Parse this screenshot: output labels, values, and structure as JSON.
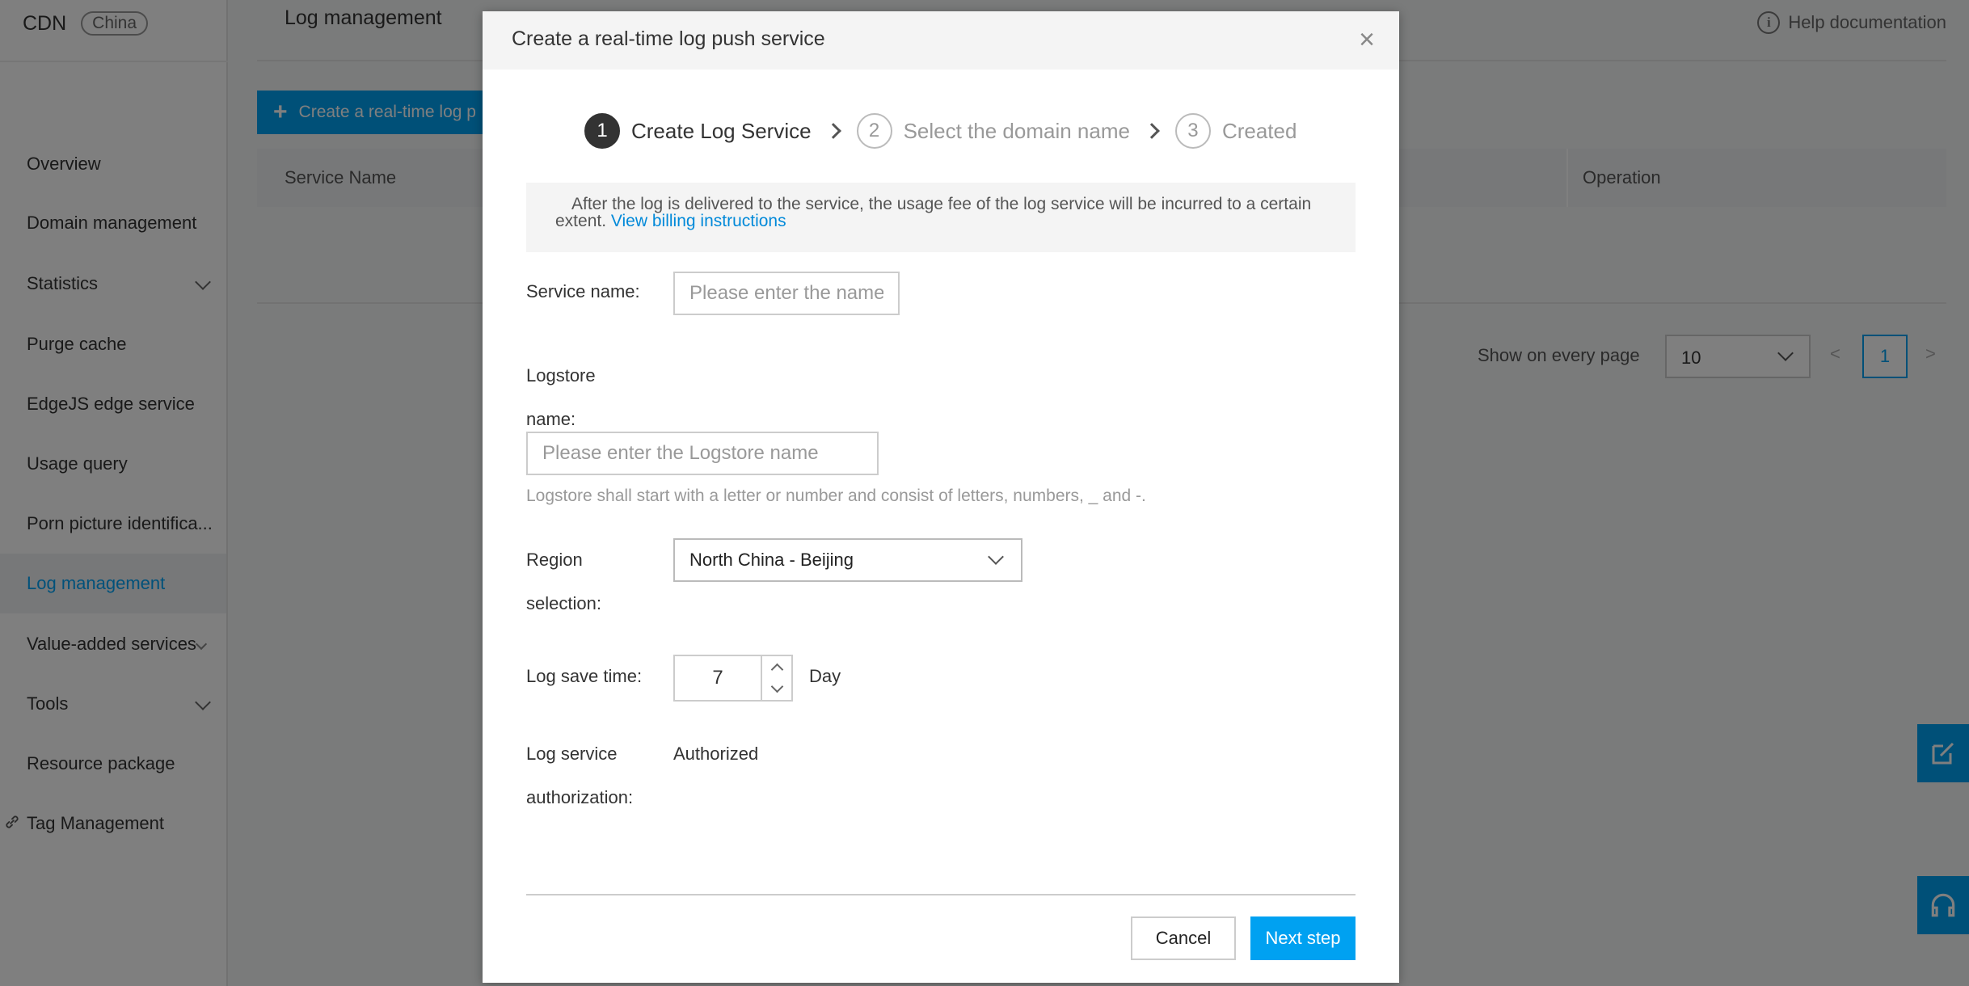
{
  "sidebar": {
    "brand": "CDN",
    "region_badge": "China",
    "items": [
      {
        "label": "Overview"
      },
      {
        "label": "Domain management"
      },
      {
        "label": "Statistics"
      },
      {
        "label": "Purge cache"
      },
      {
        "label": "EdgeJS edge service"
      },
      {
        "label": "Usage query"
      },
      {
        "label": "Porn picture identifica..."
      },
      {
        "label": "Log management"
      },
      {
        "label": "Value-added services"
      },
      {
        "label": "Tools"
      },
      {
        "label": "Resource package"
      },
      {
        "label": "Tag Management"
      }
    ]
  },
  "main": {
    "title": "Log management",
    "help": "Help documentation",
    "create_button": "Create a real-time log p",
    "table": {
      "columns": [
        "Service Name",
        "Operation"
      ]
    },
    "pager": {
      "label": "Show on every page",
      "page_size": "10",
      "prev": "<",
      "current": "1",
      "next": ">"
    }
  },
  "modal": {
    "title": "Create a real-time log push service",
    "close": "×",
    "steps": [
      {
        "num": "1",
        "label": "Create Log Service"
      },
      {
        "num": "2",
        "label": "Select the domain name"
      },
      {
        "num": "3",
        "label": "Created"
      }
    ],
    "notice": {
      "text": "After the log is delivered to the service, the usage fee of the log service will be incurred to a certain extent.",
      "link": "View billing instructions"
    },
    "service_name": {
      "label": "Service name:",
      "placeholder": "Please enter the names consisting of",
      "value": ""
    },
    "logstore": {
      "label_line1": "Logstore",
      "label_line2": "name:",
      "placeholder": "Please enter the Logstore name",
      "value": "",
      "hint": "Logstore shall start with a letter or number and consist of letters, numbers, _ and -."
    },
    "region": {
      "label_line1": "Region",
      "label_line2": "selection:",
      "value": "North China - Beijing"
    },
    "save_time": {
      "label": "Log save time:",
      "value": "7",
      "unit": "Day"
    },
    "authorization": {
      "label_line1": "Log service",
      "label_line2": "authorization:",
      "value": "Authorized"
    },
    "buttons": {
      "cancel": "Cancel",
      "next": "Next step"
    }
  }
}
